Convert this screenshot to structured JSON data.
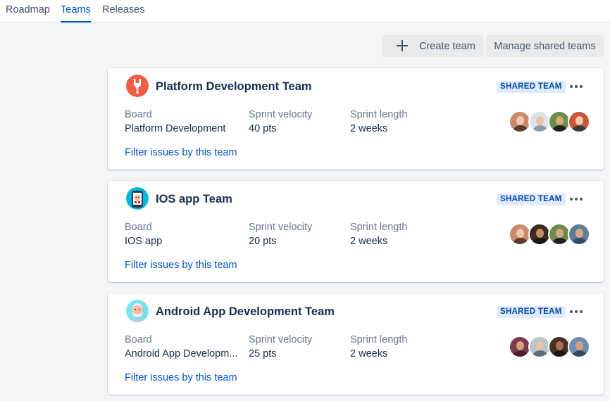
{
  "nav": {
    "tabs": [
      {
        "label": "Roadmap"
      },
      {
        "label": "Teams"
      },
      {
        "label": "Releases"
      }
    ],
    "active_tab": "Teams"
  },
  "toolbar": {
    "create_label": "Create team",
    "manage_label": "Manage shared teams"
  },
  "labels": {
    "board": "Board",
    "velocity": "Sprint velocity",
    "length": "Sprint length",
    "filter": "Filter issues by this team",
    "badge": "SHARED TEAM"
  },
  "colors": {
    "accent": "#0052cc",
    "badge_bg": "#deebff",
    "badge_text": "#0747a6"
  },
  "teams": [
    {
      "name": "Platform Development Team",
      "icon": "wrench-icon",
      "board": "Platform Development",
      "velocity": "40 pts",
      "length": "2 weeks"
    },
    {
      "name": "IOS app Team",
      "icon": "phone-robot-icon",
      "board": "IOS app",
      "velocity": "20 pts",
      "length": "2 weeks"
    },
    {
      "name": "Android App Development Team",
      "icon": "bearded-person-icon",
      "board": "Android App Developm...",
      "velocity": "25 pts",
      "length": "2 weeks"
    }
  ]
}
